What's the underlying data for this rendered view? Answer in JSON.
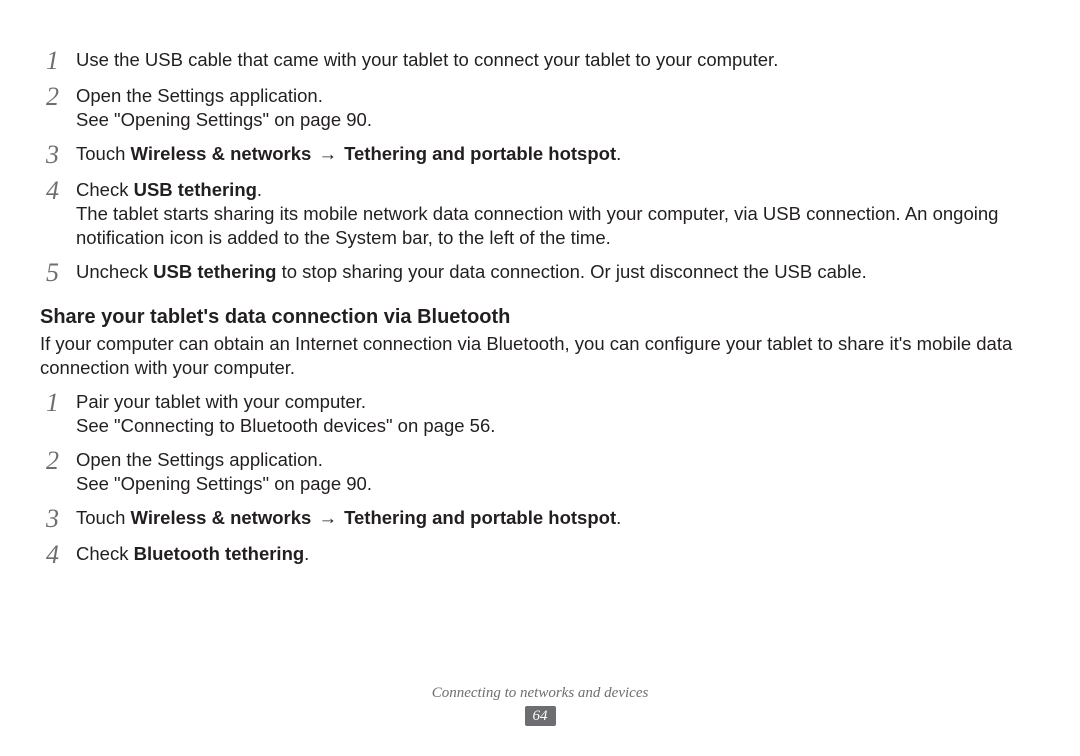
{
  "section_a_steps": [
    {
      "num": "1",
      "lines": [
        "Use the USB cable that came with your tablet to connect your tablet to your computer."
      ]
    },
    {
      "num": "2",
      "lines": [
        "Open the Settings application.",
        "See \"Opening Settings\" on page 90."
      ]
    },
    {
      "num": "3",
      "prefix": "Touch ",
      "bold1": "Wireless & networks",
      "mid": " → ",
      "bold2": "Tethering and portable hotspot",
      "suffix": "."
    },
    {
      "num": "4",
      "prefix": "Check ",
      "bold1": "USB tethering",
      "suffix": ".",
      "lines_after": [
        "The tablet starts sharing its mobile network data connection with your computer, via USB connection. An ongoing notification icon is added to the System bar, to the left of the time."
      ]
    },
    {
      "num": "5",
      "prefix": "Uncheck ",
      "bold1": "USB tethering",
      "suffix": " to stop sharing your data connection. Or just disconnect the USB cable."
    }
  ],
  "section_b": {
    "heading": "Share your tablet's data connection via Bluetooth",
    "intro": "If your computer can obtain an Internet connection via Bluetooth, you can configure your tablet to share it's mobile data connection with your computer.",
    "steps": [
      {
        "num": "1",
        "lines": [
          "Pair your tablet with your computer.",
          "See \"Connecting to Bluetooth devices\" on page 56."
        ]
      },
      {
        "num": "2",
        "lines": [
          "Open the Settings application.",
          "See \"Opening Settings\" on page 90."
        ]
      },
      {
        "num": "3",
        "prefix": "Touch ",
        "bold1": "Wireless & networks",
        "mid": " → ",
        "bold2": "Tethering and portable hotspot",
        "suffix": "."
      },
      {
        "num": "4",
        "prefix": "Check ",
        "bold1": "Bluetooth tethering",
        "suffix": "."
      }
    ]
  },
  "footer": {
    "chapter": "Connecting to networks and devices",
    "page": "64"
  }
}
